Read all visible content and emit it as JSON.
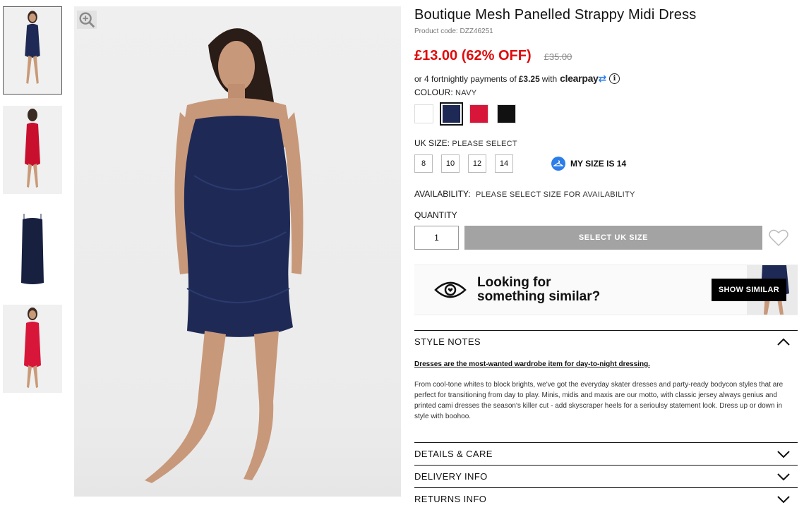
{
  "product": {
    "title": "Boutique Mesh Panelled Strappy Midi Dress",
    "code": "Product code: DZZ46251",
    "price_now": "£13.00 (62% OFF)",
    "price_was": "£35.00"
  },
  "clearpay": {
    "prefix": "or 4 fortnightly payments of",
    "amount": "£3.25",
    "suffix": "with",
    "brand": "clearpay"
  },
  "colour": {
    "label": "COLOUR:",
    "value": "NAVY",
    "swatches": [
      {
        "name": "white",
        "color": "#ffffff"
      },
      {
        "name": "navy",
        "color": "#1e2a55"
      },
      {
        "name": "red",
        "color": "#d8163a"
      },
      {
        "name": "black",
        "color": "#111111"
      }
    ]
  },
  "size": {
    "label": "UK SIZE:",
    "value": "PLEASE SELECT",
    "options": [
      "8",
      "10",
      "12",
      "14"
    ],
    "my_size": "MY SIZE IS 14"
  },
  "availability": {
    "label": "AVAILABILITY:",
    "value": "PLEASE SELECT SIZE FOR AVAILABILITY"
  },
  "quantity": {
    "label": "QUANTITY",
    "value": "1"
  },
  "add_button": "SELECT UK SIZE",
  "similar": {
    "line1": "Looking for",
    "line2": "something similar?",
    "button": "SHOW SIMILAR"
  },
  "accordion": {
    "style_notes": "STYLE NOTES",
    "notes_lead": "Dresses are the most-wanted wardrobe item for day-to-night dressing.",
    "notes_body": "From cool-tone whites to block brights, we've got the everyday skater dresses and party-ready bodycon styles that are perfect for transitioning from day to play. Minis, midis and maxis are our motto, with classic jersey always genius and printed cami dresses the season's killer cut - add skyscraper heels for a seriouls​y statement look. Dress up or down in style with boohoo.",
    "details": "DETAILS & CARE",
    "delivery": "DELIVERY INFO",
    "returns": "RETURNS INFO"
  },
  "colors": {
    "sale_red": "#e00b0b",
    "navy": "#1e2a55",
    "button_grey": "#a3a3a3",
    "clearpay_blue": "#2b7de9"
  }
}
